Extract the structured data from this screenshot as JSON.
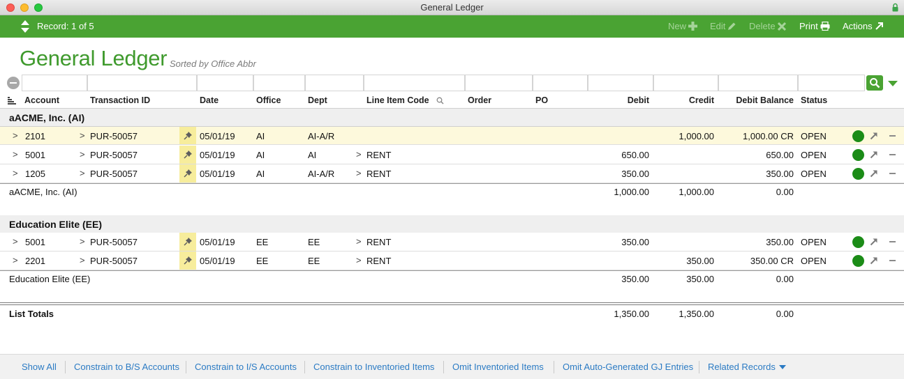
{
  "window": {
    "title": "General Ledger"
  },
  "toolbar": {
    "record_label": "Record: 1 of 5",
    "new_label": "New",
    "edit_label": "Edit",
    "delete_label": "Delete",
    "print_label": "Print",
    "actions_label": "Actions"
  },
  "heading": {
    "title": "General Ledger",
    "sorted_by": "Sorted by Office Abbr"
  },
  "columns": {
    "account": "Account",
    "transaction_id": "Transaction ID",
    "date": "Date",
    "office": "Office",
    "dept": "Dept",
    "line_item_code": "Line Item Code",
    "order": "Order",
    "po": "PO",
    "debit": "Debit",
    "credit": "Credit",
    "debit_balance": "Debit Balance",
    "status": "Status"
  },
  "groups": [
    {
      "title": "aACME, Inc.  (AI)",
      "rows": [
        {
          "chevron": ">",
          "account": "2101",
          "txn_chevron": ">",
          "transaction_id": "PUR-50057",
          "date": "05/01/19",
          "office": "AI",
          "dept": "AI-A/R",
          "lic_chevron": "",
          "line_item_code": "",
          "debit": "",
          "credit": "1,000.00",
          "debit_balance": "1,000.00 CR",
          "status": "OPEN"
        },
        {
          "chevron": ">",
          "account": "5001",
          "txn_chevron": ">",
          "transaction_id": "PUR-50057",
          "date": "05/01/19",
          "office": "AI",
          "dept": "AI",
          "lic_chevron": ">",
          "line_item_code": "RENT",
          "debit": "650.00",
          "credit": "",
          "debit_balance": "650.00",
          "status": "OPEN"
        },
        {
          "chevron": ">",
          "account": "1205",
          "txn_chevron": ">",
          "transaction_id": "PUR-50057",
          "date": "05/01/19",
          "office": "AI",
          "dept": "AI-A/R",
          "lic_chevron": ">",
          "line_item_code": "RENT",
          "debit": "350.00",
          "credit": "",
          "debit_balance": "350.00",
          "status": "OPEN"
        }
      ],
      "subtotal": {
        "label": "aACME, Inc.  (AI)",
        "debit": "1,000.00",
        "credit": "1,000.00",
        "debit_balance": "0.00"
      }
    },
    {
      "title": "Education Elite  (EE)",
      "rows": [
        {
          "chevron": ">",
          "account": "5001",
          "txn_chevron": ">",
          "transaction_id": "PUR-50057",
          "date": "05/01/19",
          "office": "EE",
          "dept": "EE",
          "lic_chevron": ">",
          "line_item_code": "RENT",
          "debit": "350.00",
          "credit": "",
          "debit_balance": "350.00",
          "status": "OPEN"
        },
        {
          "chevron": ">",
          "account": "2201",
          "txn_chevron": ">",
          "transaction_id": "PUR-50057",
          "date": "05/01/19",
          "office": "EE",
          "dept": "EE",
          "lic_chevron": ">",
          "line_item_code": "RENT",
          "debit": "",
          "credit": "350.00",
          "debit_balance": "350.00 CR",
          "status": "OPEN"
        }
      ],
      "subtotal": {
        "label": "Education Elite  (EE)",
        "debit": "350.00",
        "credit": "350.00",
        "debit_balance": "0.00"
      }
    }
  ],
  "totals": {
    "label": "List Totals",
    "debit": "1,350.00",
    "credit": "1,350.00",
    "debit_balance": "0.00"
  },
  "footer": {
    "links": [
      "Show All",
      "Constrain to B/S Accounts",
      "Constrain to I/S Accounts",
      "Constrain to Inventoried Items",
      "Omit Inventoried Items",
      "Omit Auto-Generated GJ Entries",
      "Related Records"
    ]
  },
  "colors": {
    "accent": "#4aa333",
    "title_green": "#3f9a2d",
    "pin_yellow": "#f7ed9c",
    "selected_row": "#fdf9dc",
    "link_blue": "#2b7bc4",
    "status_green": "#1b8c17"
  }
}
